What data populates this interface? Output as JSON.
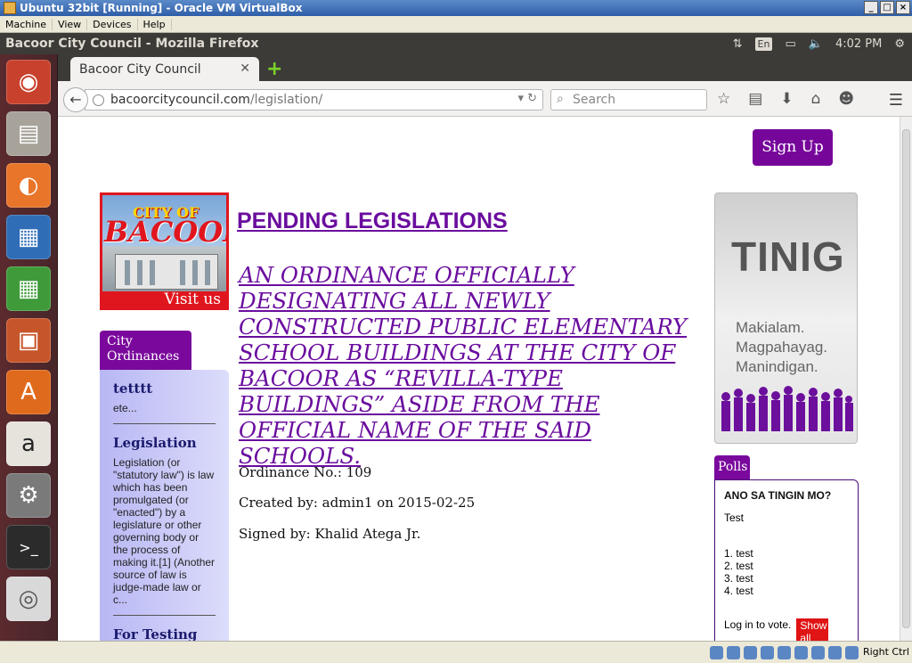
{
  "vbox": {
    "title": "Ubuntu 32bit [Running] - Oracle VM VirtualBox",
    "menu": [
      "Machine",
      "View",
      "Devices",
      "Help"
    ],
    "host_key": "Right Ctrl"
  },
  "ubuntu_panel": {
    "window_title": "Bacoor City Council - Mozilla Firefox",
    "lang": "En",
    "time": "4:02 PM"
  },
  "launcher": {
    "items": [
      "ubuntu-dash",
      "files",
      "firefox",
      "libreoffice-writer",
      "libreoffice-calc",
      "libreoffice-impress",
      "ubuntu-software-center",
      "amazon",
      "system-settings",
      "terminal",
      "dvd"
    ]
  },
  "firefox": {
    "tab_title": "Bacoor City Council",
    "url_domain": "bacoorcitycouncil.com",
    "url_path": "/legislation/",
    "search_placeholder": "Search"
  },
  "page": {
    "signup": "Sign Up",
    "logo": {
      "line1": "CITY OF",
      "line2": "BACOOR",
      "visit": "Visit us"
    },
    "heading": "PENDING LEGISLATIONS",
    "ordinance_title": "AN ORDINANCE OFFICIALLY DESIGNATING ALL NEWLY CONSTRUCTED PUBLIC ELEMENTARY SCHOOL BUILDINGS AT THE CITY OF BACOOR AS “REVILLA-TYPE BUILDINGS” ASIDE FROM THE OFFICIAL NAME OF THE SAID SCHOOLS.",
    "ordinance_no": "Ordinance No.: 109",
    "created_by": "Created by: admin1 on 2015-02-25",
    "signed_by": "Signed by: Khalid Atega Jr.",
    "sidebar": {
      "tab": "City Ordinances",
      "items": [
        {
          "title": "tetttt",
          "text": "ete..."
        },
        {
          "title": "Legislation",
          "text": "Legislation (or \"statutory law\") is law which has been promulgated (or \"enacted\") by a legislature or other governing body or the process of making it.[1] (Another source of law is judge-made law or c..."
        },
        {
          "title": "For Testing of"
        }
      ]
    },
    "ad": {
      "big": "TINIG",
      "lines": [
        "Makialam.",
        "Magpahayag.",
        "Manindigan."
      ]
    },
    "polls": {
      "tab": "Polls",
      "question": "ANO SA TINGIN MO?",
      "desc": "Test",
      "options": [
        "1. test",
        "2. test",
        "3. test",
        "4. test"
      ],
      "login": "Log in to vote.",
      "show_all": "Show all"
    }
  },
  "colors": {
    "accent": "#7a089c",
    "link": "#6a0d9e",
    "logo_red": "#e0161e"
  }
}
